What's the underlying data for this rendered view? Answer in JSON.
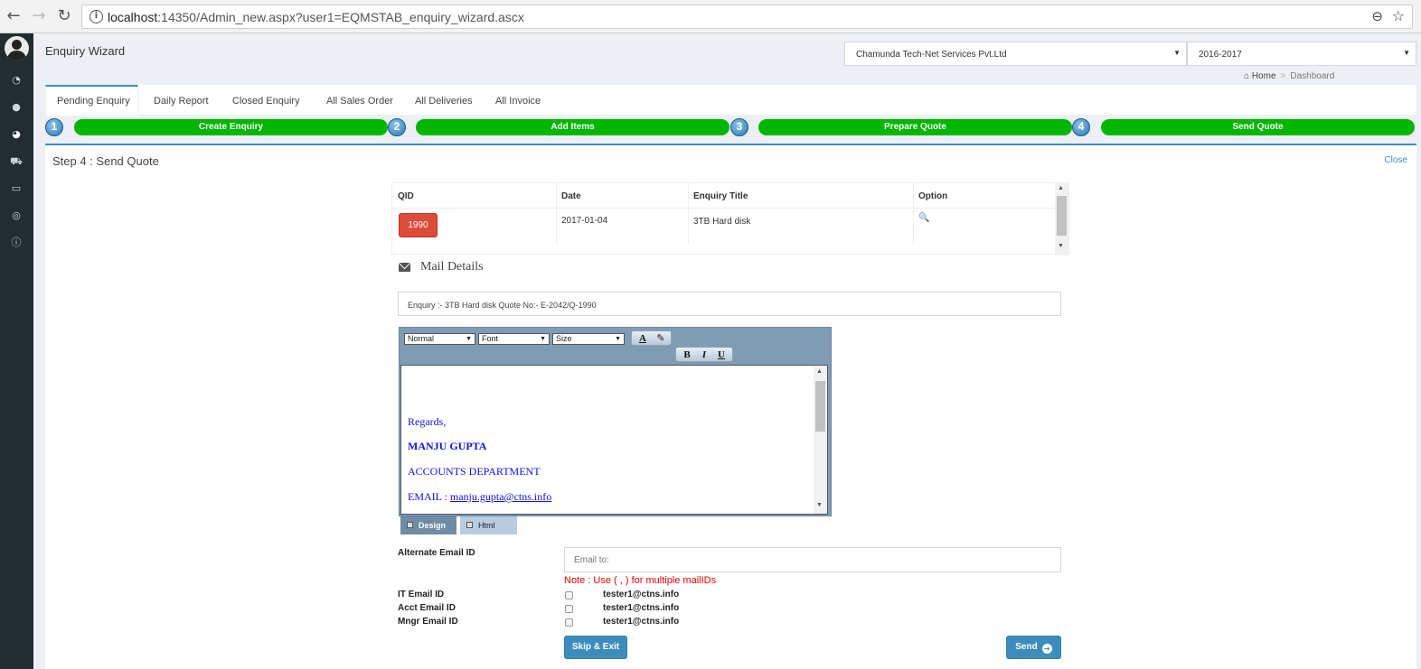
{
  "browser": {
    "url_host": "localhost",
    "url_rest": ":14350/Admin_new.aspx?user1=EQMSTAB_enquiry_wizard.ascx",
    "back_icon": "←",
    "forward_icon": "→",
    "reload_icon": "↻",
    "info_icon": "i",
    "zoom_icon": "⊖",
    "star_icon": "☆"
  },
  "header": {
    "title": "Enquiry Wizard",
    "company": "Chamunda Tech-Net Services Pvt.Ltd",
    "year": "2016-2017",
    "arrow": "▼",
    "breadcrumb_home": "Home",
    "breadcrumb_sep": ">",
    "breadcrumb_current": "Dashboard",
    "home_icon": "⌂"
  },
  "sidebar_icons": [
    "◔",
    "●",
    "◕",
    "⛟",
    "▭",
    "◎",
    "ⓘ"
  ],
  "tabs": [
    {
      "label": "Pending Enquiry"
    },
    {
      "label": "Daily Report"
    },
    {
      "label": "Closed Enquiry"
    },
    {
      "label": "All Sales Order"
    },
    {
      "label": "All Deliveries"
    },
    {
      "label": "All Invoice"
    }
  ],
  "wizard": [
    {
      "num": "1",
      "label": "Create Enquiry"
    },
    {
      "num": "2",
      "label": "Add Items"
    },
    {
      "num": "3",
      "label": "Prepare Quote"
    },
    {
      "num": "4",
      "label": "Send Quote"
    }
  ],
  "panel": {
    "step_title": "Step 4 : Send Quote",
    "close": "Close"
  },
  "table": {
    "headers": [
      "QID",
      "Date",
      "Enquiry Title",
      "Option"
    ],
    "row": {
      "qid": "1990",
      "date": "2017-01-04",
      "title": "3TB Hard disk",
      "option_icon": "🔍"
    },
    "scroll_up": "▲",
    "scroll_down": "▼"
  },
  "mail": {
    "title": "Mail Details",
    "subject": "Enquiry :- 3TB Hard disk  Quote No:- E-2042/Q-1990",
    "editor": {
      "format": "Normal",
      "font": "Font",
      "size": "Size",
      "fore_icon": "A",
      "back_icon": "✎",
      "bold": "B",
      "italic": "I",
      "underline": "U",
      "lines": [
        "Regards,",
        "MANJU GUPTA",
        "ACCOUNTS DEPARTMENT"
      ],
      "email_prefix": "EMAIL : ",
      "email": "manju.gupta@ctns.info",
      "design_tab": "Design",
      "html_tab": "Html"
    }
  },
  "form": {
    "alt_label": "Alternate Email ID",
    "alt_placeholder": "Email to:",
    "note": "Note : Use ( , ) for multiple mailIDs",
    "rows": [
      {
        "label": "IT Email ID",
        "email": "tester1@ctns.info"
      },
      {
        "label": "Acct Email ID",
        "email": "tester1@ctns.info"
      },
      {
        "label": "Mngr Email ID",
        "email": "tester1@ctns.info"
      }
    ],
    "skip_button": "Skip & Exit",
    "send_button": "Send",
    "send_icon": "➔"
  }
}
